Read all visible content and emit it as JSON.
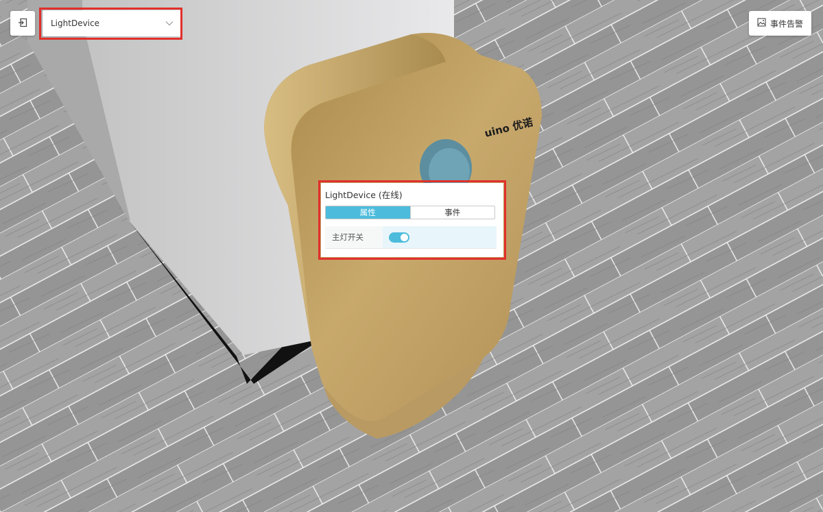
{
  "device_selector": {
    "value": "LightDevice"
  },
  "alarm_button": {
    "label": "事件告警"
  },
  "device_panel": {
    "title": "LightDevice (在线)",
    "tabs": [
      {
        "label": "属性",
        "active": true
      },
      {
        "label": "事件",
        "active": false
      }
    ],
    "properties": [
      {
        "label": "主灯开关",
        "toggle_on": true
      }
    ]
  },
  "scene": {
    "product_logo": "UINO 优诺"
  },
  "colors": {
    "accent": "#4dbcdc",
    "highlight_frame": "#e0302b",
    "device_gold": "#b7955a"
  }
}
